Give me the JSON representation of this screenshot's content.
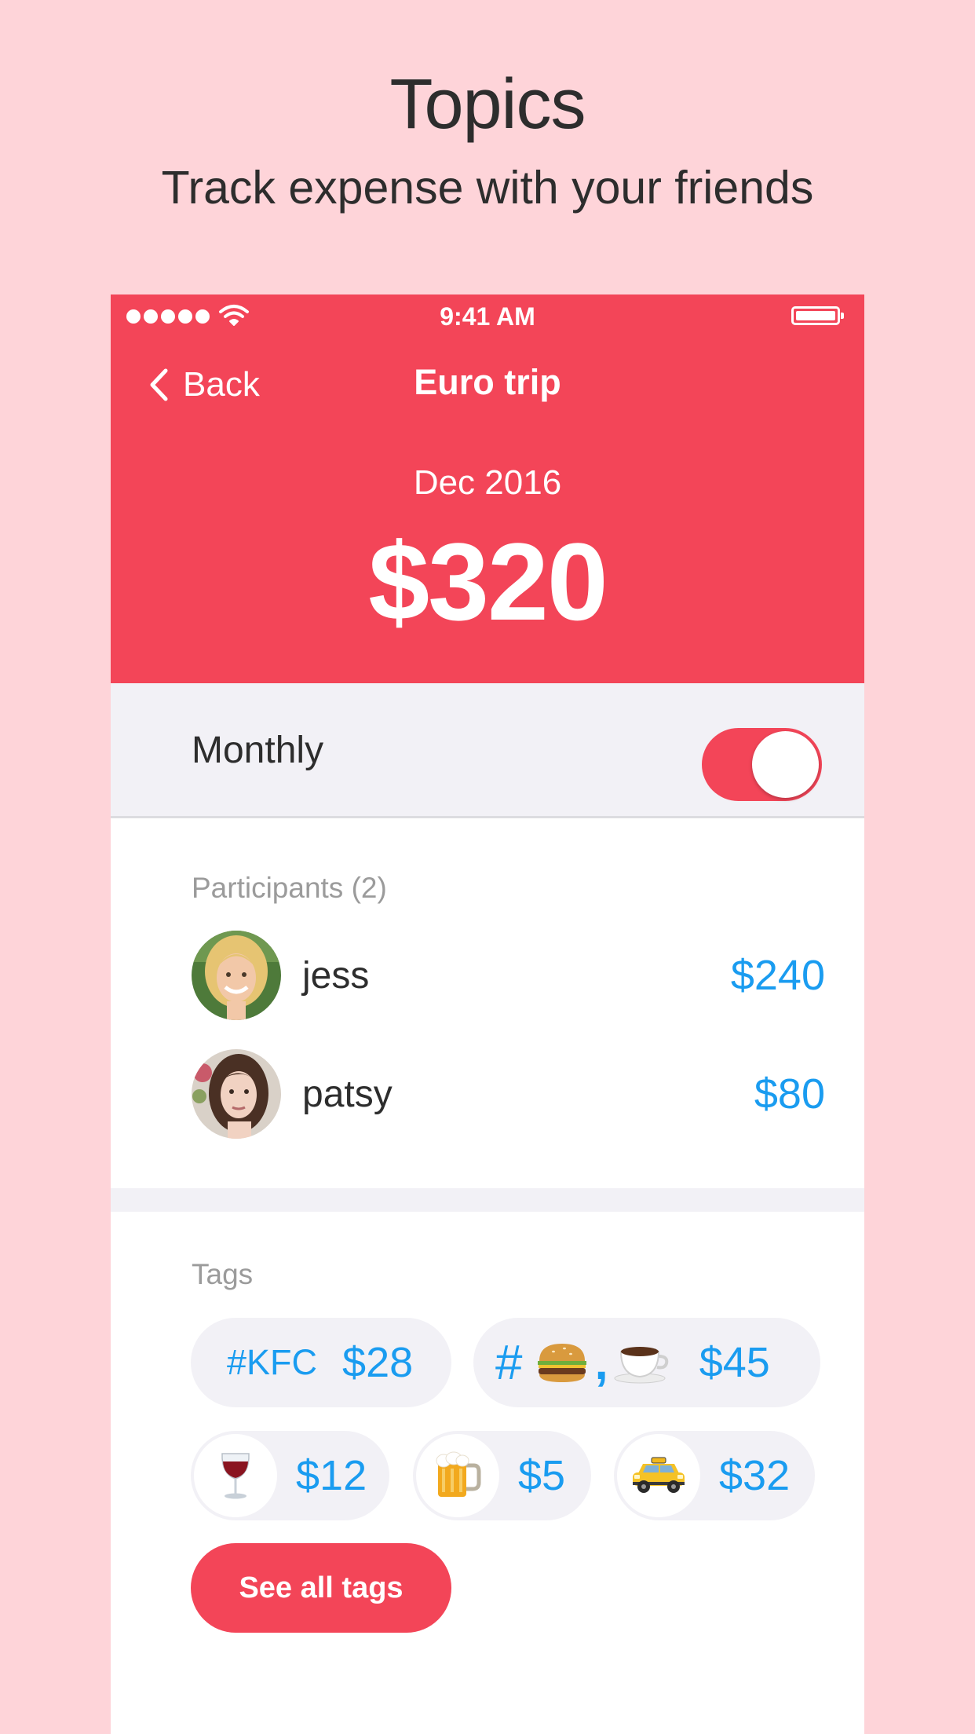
{
  "promo": {
    "title": "Topics",
    "subtitle": "Track expense with your friends"
  },
  "status_bar": {
    "time": "9:41 AM"
  },
  "nav": {
    "back_label": "Back",
    "title": "Euro trip"
  },
  "summary": {
    "period": "Dec 2016",
    "total": "$320"
  },
  "monthly": {
    "label": "Monthly",
    "enabled": true
  },
  "participants": {
    "label": "Participants (2)",
    "items": [
      {
        "name": "jess",
        "amount": "$240"
      },
      {
        "name": "patsy",
        "amount": "$80"
      }
    ]
  },
  "tags": {
    "label": "Tags",
    "items": [
      {
        "text": "#KFC",
        "amount": "$28"
      },
      {
        "text": "#",
        "icons": [
          "burger-icon",
          "coffee-icon"
        ],
        "separator": ",",
        "amount": "$45"
      },
      {
        "icon": "wine-glass-icon",
        "amount": "$12"
      },
      {
        "icon": "beer-mug-icon",
        "amount": "$5"
      },
      {
        "icon": "taxi-icon",
        "amount": "$32"
      }
    ],
    "see_all_label": "See all tags"
  },
  "colors": {
    "background": "#fed4d9",
    "accent": "#f34558",
    "amount_blue": "#1a9cf0",
    "section_gray": "#f2f1f6"
  }
}
